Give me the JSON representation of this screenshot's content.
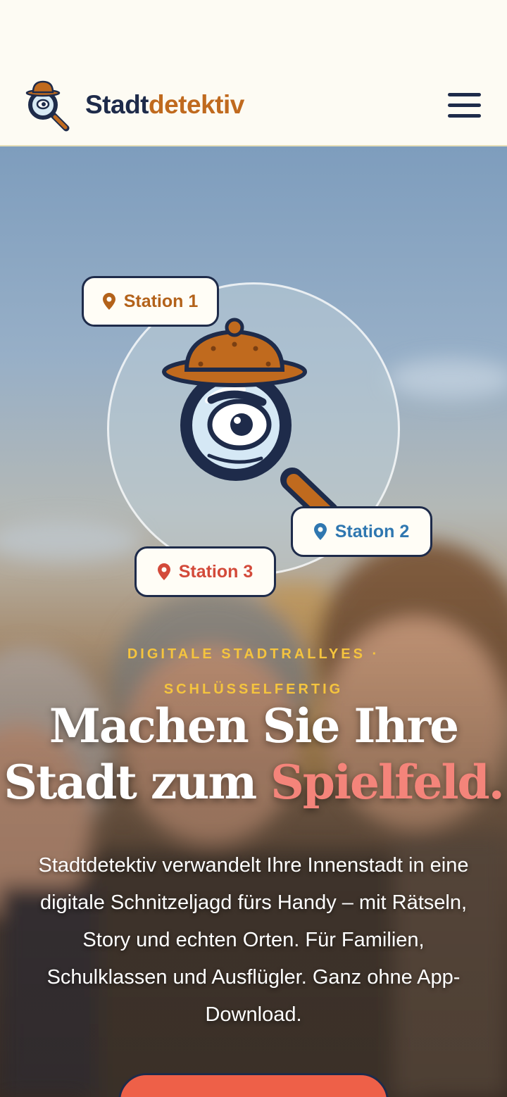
{
  "header": {
    "brand_part1": "Stadt",
    "brand_part2": "detektiv",
    "logo_icon": "detective-magnifier-icon",
    "menu_icon": "hamburger-menu-icon"
  },
  "hero": {
    "stations": [
      {
        "label": "Station 1",
        "icon": "map-pin-icon",
        "color": "#b3621a"
      },
      {
        "label": "Station 2",
        "icon": "map-pin-icon",
        "color": "#2f77b0"
      },
      {
        "label": "Station 3",
        "icon": "map-pin-icon",
        "color": "#d34a3a"
      }
    ],
    "eyebrow_line1": "DIGITALE STADTRALLYES ·",
    "eyebrow_line2": "SCHLÜSSELFERTIG",
    "headline_line1": "Machen Sie Ihre",
    "headline_line2_plain": "Stadt zum ",
    "headline_accent": "Spielfeld.",
    "lead": "Stadtdetektiv verwandelt Ihre Innenstadt in eine digitale Schnitzeljagd fürs Handy – mit Rätseln, Story und echten Orten. Für Familien, Schulklassen und Ausflügler. Ganz ohne App-Download."
  },
  "colors": {
    "navy": "#1e2b4a",
    "orange": "#c06a1e",
    "accent_coral": "#f4847a",
    "highlight_yellow": "#f5c43e",
    "cta_red": "#ee6048",
    "background": "#fdfbf3"
  }
}
